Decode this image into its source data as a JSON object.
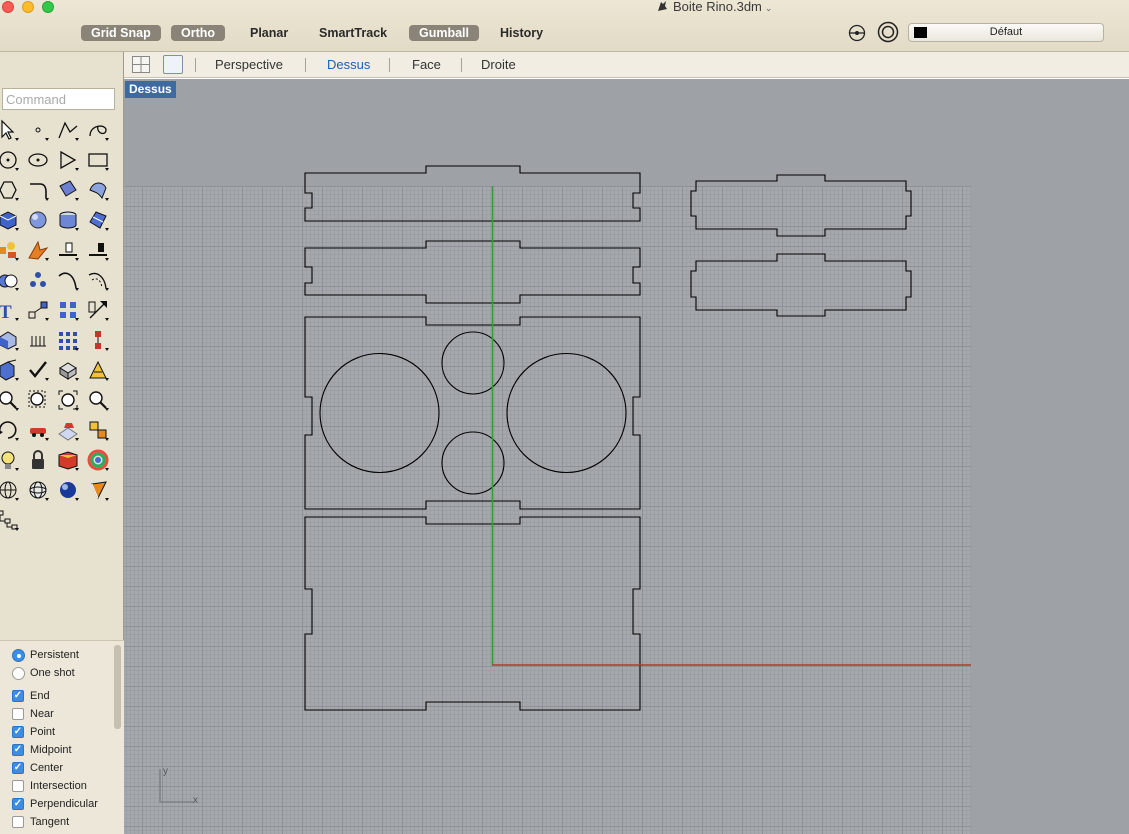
{
  "window": {
    "title": "Boite Rino.3dm"
  },
  "toolbar": {
    "buttons": [
      {
        "label": "Grid Snap",
        "active": true
      },
      {
        "label": "Ortho",
        "active": true
      },
      {
        "label": "Planar",
        "active": false
      },
      {
        "label": "SmartTrack",
        "active": false
      },
      {
        "label": "Gumball",
        "active": true
      },
      {
        "label": "History",
        "active": false
      }
    ],
    "layer": {
      "name": "Défaut",
      "color": "#000000"
    }
  },
  "viewport_tabs": {
    "tabs": [
      "Perspective",
      "Dessus",
      "Face",
      "Droite"
    ],
    "active": "Dessus"
  },
  "command": {
    "placeholder": "Command"
  },
  "tool_icons": [
    "select-arrow-icon",
    "point-icon",
    "polyline-icon",
    "curve-icon",
    "circle-icon",
    "ellipse-icon",
    "polygon-icon",
    "rectangle-icon",
    "polygon-tools-icon",
    "fillet-icon",
    "surface-icon",
    "loft-icon",
    "box-icon",
    "sphere-icon",
    "cylinder-icon",
    "mesh-icon",
    "transform-icon",
    "explode-icon",
    "trim-icon",
    "split-icon",
    "boolean-icon",
    "points-on-icon",
    "curve-tools-icon",
    "offset-icon",
    "text-icon",
    "gumball-move-icon",
    "array-icon",
    "dimension-icon",
    "solid-tools-icon",
    "grid-icon",
    "layout-icon",
    "hierarchy-icon",
    "extrude-icon",
    "check-icon",
    "block-icon",
    "analyze-icon",
    "zoom-icon",
    "zoom-window-icon",
    "zoom-extents-icon",
    "zoom-magnify-icon",
    "rotate-view-icon",
    "car-icon",
    "render-grid-icon",
    "snapshot-icon",
    "light-icon",
    "lock-icon",
    "layer-book-icon",
    "color-wheel-icon",
    "wireframe-sphere-icon",
    "shaded-sphere-icon",
    "rendered-sphere-icon",
    "camera-target-icon",
    "object-tree-icon"
  ],
  "osnap": {
    "modes": [
      {
        "label": "Persistent",
        "selected": true
      },
      {
        "label": "One shot",
        "selected": false
      }
    ],
    "snaps": [
      {
        "label": "End",
        "checked": true
      },
      {
        "label": "Near",
        "checked": false
      },
      {
        "label": "Point",
        "checked": true
      },
      {
        "label": "Midpoint",
        "checked": true
      },
      {
        "label": "Center",
        "checked": true
      },
      {
        "label": "Intersection",
        "checked": false
      },
      {
        "label": "Perpendicular",
        "checked": true
      },
      {
        "label": "Tangent",
        "checked": false
      }
    ]
  },
  "viewport": {
    "label": "Dessus",
    "axis_labels": {
      "y": "y",
      "x": "x"
    },
    "colors": {
      "background": "#9ea1a6",
      "grid_minor": "#9ca0a5",
      "grid_major": "#8e9196",
      "x_axis": "#b03a2e",
      "y_axis": "#3a9a3a",
      "curves": "#000000"
    }
  }
}
